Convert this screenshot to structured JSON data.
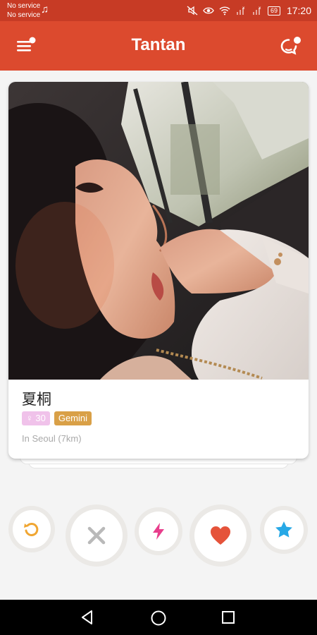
{
  "status_bar": {
    "carrier_1": "No service",
    "carrier_2": "No service",
    "battery": "69",
    "time": "17:20",
    "icons": [
      "music-note-icon",
      "mute-icon",
      "eye-icon",
      "wifi-icon",
      "signal-icon",
      "signal-icon",
      "battery-icon"
    ]
  },
  "header": {
    "title": "Tantan",
    "menu_icon": "menu-icon",
    "chat_icon": "chat-icon",
    "background": "#dc4a2e"
  },
  "profile": {
    "name": "夏桐",
    "age_icon": "female-icon",
    "age": "30",
    "zodiac": "Gemini",
    "location": "In Seoul (7km)"
  },
  "actions": [
    {
      "name": "undo-button",
      "icon": "undo-icon",
      "color": "#f0a632"
    },
    {
      "name": "nope-button",
      "icon": "close-icon",
      "color": "#b9b9b9"
    },
    {
      "name": "boost-button",
      "icon": "lightning-icon",
      "color": "#e83e8c"
    },
    {
      "name": "like-button",
      "icon": "heart-icon",
      "color": "#e5533a"
    },
    {
      "name": "super-like-button",
      "icon": "star-icon",
      "color": "#27a8e6"
    }
  ],
  "nav": {
    "icons": [
      "back-icon",
      "home-icon",
      "recents-icon"
    ]
  }
}
